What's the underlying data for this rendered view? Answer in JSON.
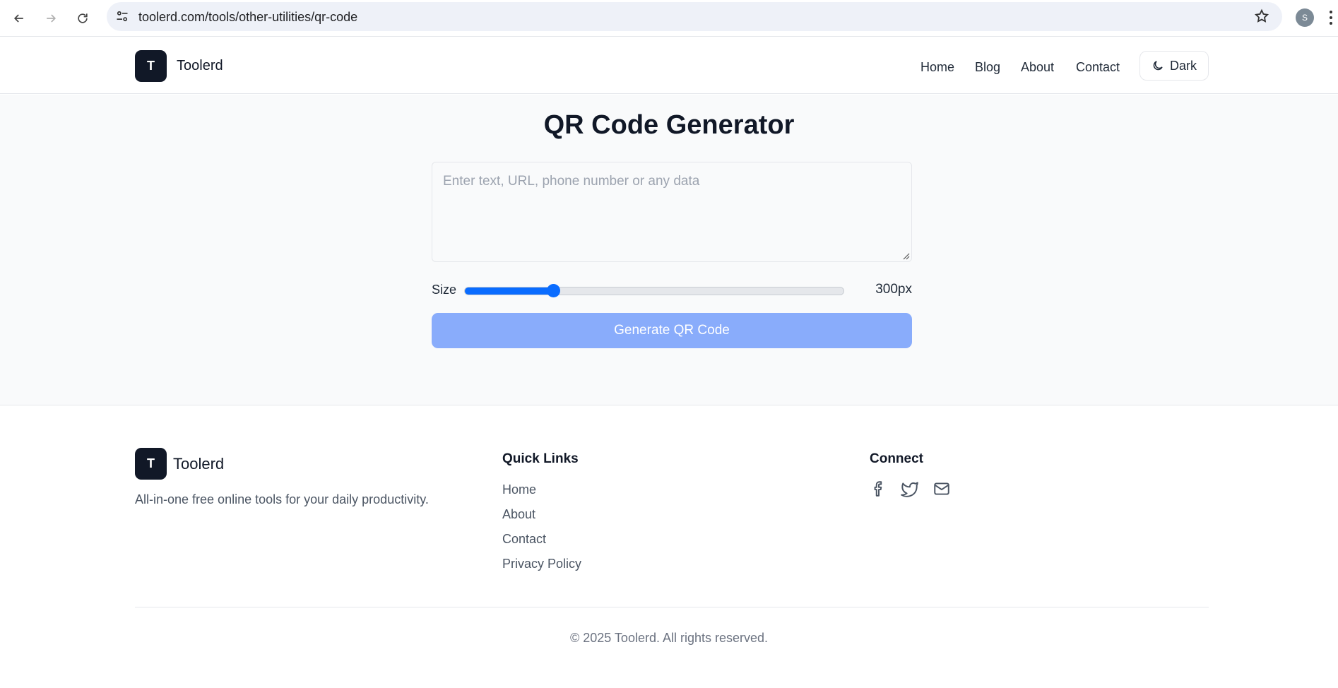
{
  "browser": {
    "url": "toolerd.com/tools/other-utilities/qr-code",
    "profile_initial": "S"
  },
  "header": {
    "logo_letter": "T",
    "brand": "Toolerd",
    "nav": [
      "Home",
      "Blog",
      "About",
      "Contact"
    ],
    "theme_button": "Dark"
  },
  "main": {
    "title": "QR Code Generator",
    "input_placeholder": "Enter text, URL, phone number or any data",
    "input_value": "",
    "size_label": "Size",
    "size_value": "300px",
    "size_fraction": 0.235,
    "generate_button": "Generate QR Code"
  },
  "footer": {
    "logo_letter": "T",
    "brand": "Toolerd",
    "description": "All-in-one free online tools for your daily productivity.",
    "quick_links_title": "Quick Links",
    "quick_links": [
      "Home",
      "About",
      "Contact",
      "Privacy Policy"
    ],
    "connect_title": "Connect",
    "social_icons": [
      "facebook-icon",
      "twitter-icon",
      "mail-icon"
    ],
    "copyright": "© 2025 Toolerd. All rights reserved."
  },
  "colors": {
    "accent": "#0a6cff",
    "button_disabled": "#89acfb",
    "logo_bg": "#111827"
  }
}
